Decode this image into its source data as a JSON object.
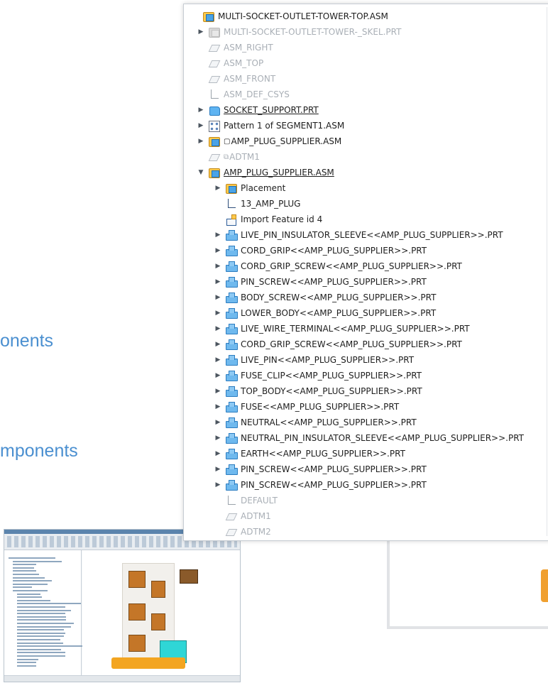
{
  "slide_text": [
    "onents",
    "mponents"
  ],
  "tree": {
    "rows": [
      {
        "depth": 0,
        "arrow": "none",
        "icon": "assembly-icon",
        "icon_cls": "ic-asm",
        "label": "MULTI-SOCKET-OUTLET-TOWER-TOP.ASM",
        "style": "normal"
      },
      {
        "depth": 1,
        "arrow": "right",
        "icon": "skeleton-icon",
        "icon_cls": "ic-asm grey",
        "label": "MULTI-SOCKET-OUTLET-TOWER-_SKEL.PRT",
        "style": "dim"
      },
      {
        "depth": 1,
        "arrow": "none",
        "icon": "datum-plane-icon",
        "icon_cls": "ic-plane",
        "label": "ASM_RIGHT",
        "style": "dim"
      },
      {
        "depth": 1,
        "arrow": "none",
        "icon": "datum-plane-icon",
        "icon_cls": "ic-plane",
        "label": "ASM_TOP",
        "style": "dim"
      },
      {
        "depth": 1,
        "arrow": "none",
        "icon": "datum-plane-icon",
        "icon_cls": "ic-plane",
        "label": "ASM_FRONT",
        "style": "dim"
      },
      {
        "depth": 1,
        "arrow": "none",
        "icon": "coordinate-system-icon",
        "icon_cls": "ic-csys",
        "label": "ASM_DEF_CSYS",
        "style": "dim"
      },
      {
        "depth": 1,
        "arrow": "right",
        "icon": "part-icon",
        "icon_cls": "ic-part",
        "label": "SOCKET_SUPPORT.PRT",
        "style": "underline"
      },
      {
        "depth": 1,
        "arrow": "right",
        "icon": "pattern-icon",
        "icon_cls": "ic-pattern",
        "label": "Pattern 1 of SEGMENT1.ASM",
        "style": "normal"
      },
      {
        "depth": 1,
        "arrow": "right",
        "icon": "assembly-icon",
        "icon_cls": "ic-asm",
        "prefix": "▢",
        "label": "AMP_PLUG_SUPPLIER.ASM",
        "style": "normal"
      },
      {
        "depth": 1,
        "arrow": "none",
        "icon": "datum-plane-icon",
        "icon_cls": "ic-plane",
        "prefix": "⧉",
        "label": "ADTM1",
        "style": "dim"
      },
      {
        "depth": 1,
        "arrow": "down",
        "icon": "assembly-icon",
        "icon_cls": "ic-asm",
        "label": "AMP_PLUG_SUPPLIER.ASM",
        "style": "underline"
      },
      {
        "depth": 2,
        "arrow": "right",
        "icon": "assembly-icon",
        "icon_cls": "ic-asm",
        "label": "Placement",
        "style": "normal"
      },
      {
        "depth": 2,
        "arrow": "none",
        "icon": "coordinate-system-icon",
        "icon_cls": "ic-csys dark",
        "label": "13_AMP_PLUG",
        "style": "normal"
      },
      {
        "depth": 2,
        "arrow": "none",
        "icon": "import-feature-icon",
        "icon_cls": "ic-import",
        "label": "Import Feature id 4",
        "style": "normal"
      },
      {
        "depth": 2,
        "arrow": "right",
        "icon": "component-icon",
        "icon_cls": "ic-comp",
        "label": "LIVE_PIN_INSULATOR_SLEEVE<<AMP_PLUG_SUPPLIER>>.PRT",
        "style": "normal"
      },
      {
        "depth": 2,
        "arrow": "right",
        "icon": "component-icon",
        "icon_cls": "ic-comp",
        "label": "CORD_GRIP<<AMP_PLUG_SUPPLIER>>.PRT",
        "style": "normal"
      },
      {
        "depth": 2,
        "arrow": "right",
        "icon": "component-icon",
        "icon_cls": "ic-comp",
        "label": "CORD_GRIP_SCREW<<AMP_PLUG_SUPPLIER>>.PRT",
        "style": "normal"
      },
      {
        "depth": 2,
        "arrow": "right",
        "icon": "component-icon",
        "icon_cls": "ic-comp",
        "label": "PIN_SCREW<<AMP_PLUG_SUPPLIER>>.PRT",
        "style": "normal"
      },
      {
        "depth": 2,
        "arrow": "right",
        "icon": "component-icon",
        "icon_cls": "ic-comp",
        "label": "BODY_SCREW<<AMP_PLUG_SUPPLIER>>.PRT",
        "style": "normal"
      },
      {
        "depth": 2,
        "arrow": "right",
        "icon": "component-icon",
        "icon_cls": "ic-comp",
        "label": "LOWER_BODY<<AMP_PLUG_SUPPLIER>>.PRT",
        "style": "normal"
      },
      {
        "depth": 2,
        "arrow": "right",
        "icon": "component-icon",
        "icon_cls": "ic-comp",
        "label": "LIVE_WIRE_TERMINAL<<AMP_PLUG_SUPPLIER>>.PRT",
        "style": "normal"
      },
      {
        "depth": 2,
        "arrow": "right",
        "icon": "component-icon",
        "icon_cls": "ic-comp",
        "label": "CORD_GRIP_SCREW<<AMP_PLUG_SUPPLIER>>.PRT",
        "style": "normal"
      },
      {
        "depth": 2,
        "arrow": "right",
        "icon": "component-icon",
        "icon_cls": "ic-comp",
        "label": "LIVE_PIN<<AMP_PLUG_SUPPLIER>>.PRT",
        "style": "normal"
      },
      {
        "depth": 2,
        "arrow": "right",
        "icon": "component-icon",
        "icon_cls": "ic-comp",
        "label": "FUSE_CLIP<<AMP_PLUG_SUPPLIER>>.PRT",
        "style": "normal"
      },
      {
        "depth": 2,
        "arrow": "right",
        "icon": "component-icon",
        "icon_cls": "ic-comp",
        "label": "TOP_BODY<<AMP_PLUG_SUPPLIER>>.PRT",
        "style": "normal"
      },
      {
        "depth": 2,
        "arrow": "right",
        "icon": "component-icon",
        "icon_cls": "ic-comp",
        "label": "FUSE<<AMP_PLUG_SUPPLIER>>.PRT",
        "style": "normal"
      },
      {
        "depth": 2,
        "arrow": "right",
        "icon": "component-icon",
        "icon_cls": "ic-comp",
        "label": "NEUTRAL<<AMP_PLUG_SUPPLIER>>.PRT",
        "style": "normal"
      },
      {
        "depth": 2,
        "arrow": "right",
        "icon": "component-icon",
        "icon_cls": "ic-comp",
        "label": "NEUTRAL_PIN_INSULATOR_SLEEVE<<AMP_PLUG_SUPPLIER>>.PRT",
        "style": "normal"
      },
      {
        "depth": 2,
        "arrow": "right",
        "icon": "component-icon",
        "icon_cls": "ic-comp",
        "label": "EARTH<<AMP_PLUG_SUPPLIER>>.PRT",
        "style": "normal"
      },
      {
        "depth": 2,
        "arrow": "right",
        "icon": "component-icon",
        "icon_cls": "ic-comp",
        "label": "PIN_SCREW<<AMP_PLUG_SUPPLIER>>.PRT",
        "style": "normal"
      },
      {
        "depth": 2,
        "arrow": "right",
        "icon": "component-icon",
        "icon_cls": "ic-comp",
        "label": "PIN_SCREW<<AMP_PLUG_SUPPLIER>>.PRT",
        "style": "normal"
      },
      {
        "depth": 2,
        "arrow": "none",
        "icon": "coordinate-system-icon",
        "icon_cls": "ic-csys",
        "label": "DEFAULT",
        "style": "dim"
      },
      {
        "depth": 2,
        "arrow": "none",
        "icon": "datum-plane-icon",
        "icon_cls": "ic-plane",
        "label": "ADTM1",
        "style": "dim"
      },
      {
        "depth": 2,
        "arrow": "none",
        "icon": "datum-plane-icon",
        "icon_cls": "ic-plane",
        "label": "ADTM2",
        "style": "dim"
      }
    ]
  },
  "colors": {
    "slide_text": "#4a8fd0",
    "assembly_icon": "#ffc94a",
    "part_icon": "#5fb4f2",
    "dim_text": "#a9afb6"
  }
}
